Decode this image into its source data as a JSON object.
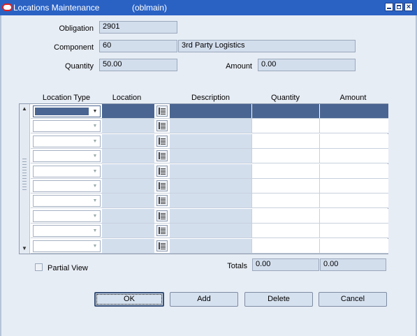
{
  "window": {
    "title": "Locations Maintenance",
    "subtitle": "(oblmain)",
    "buttons": {
      "minimize": "minimize-icon",
      "maximize": "maximize-icon",
      "close": "close-icon"
    },
    "close_glyph": "×"
  },
  "header": {
    "obligation_label": "Obligation",
    "obligation_value": "2901",
    "component_label": "Component",
    "component_value": "60",
    "component_desc": "3rd Party Logistics",
    "quantity_label": "Quantity",
    "quantity_value": "50.00",
    "amount_label": "Amount",
    "amount_value": "0.00"
  },
  "grid": {
    "columns": [
      "Location Type",
      "Location",
      "Description",
      "Quantity",
      "Amount"
    ],
    "row_count": 10,
    "selected_row": 0
  },
  "footer": {
    "partial_view_label": "Partial View",
    "partial_view_checked": false,
    "totals_label": "Totals",
    "total_quantity": "0.00",
    "total_amount": "0.00"
  },
  "buttons": {
    "ok": "OK",
    "add": "Add",
    "delete": "Delete",
    "cancel": "Cancel"
  },
  "colors": {
    "titlebar": "#2a62c4",
    "selected_row": "#4a6591",
    "readonly_field": "#d3deed",
    "background": "#e7edf5"
  }
}
